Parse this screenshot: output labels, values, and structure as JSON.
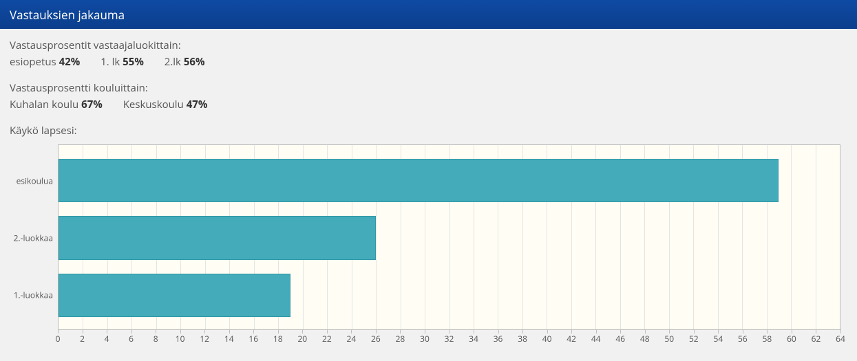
{
  "header": {
    "title": "Vastauksien jakauma"
  },
  "intro": {
    "byClass": {
      "heading": "Vastausprosentit vastaajaluokittain:",
      "items": [
        {
          "label": "esiopetus",
          "value": "42%"
        },
        {
          "label": "1. lk",
          "value": "55%"
        },
        {
          "label": "2.lk",
          "value": "56%"
        }
      ]
    },
    "bySchool": {
      "heading": "Vastausprosentti kouluittain:",
      "items": [
        {
          "label": "Kuhalan koulu",
          "value": "67%"
        },
        {
          "label": "Keskuskoulu",
          "value": "47%"
        }
      ]
    },
    "question": "Käykö lapsesi:"
  },
  "chart_data": {
    "type": "bar",
    "orientation": "horizontal",
    "categories": [
      "esikoulua",
      "2.-luokkaa",
      "1.-luokkaa"
    ],
    "values": [
      59,
      26,
      19
    ],
    "xlabel": "",
    "ylabel": "",
    "xlim": [
      0,
      64
    ],
    "xticks": [
      0,
      2,
      4,
      6,
      8,
      10,
      12,
      14,
      16,
      18,
      20,
      22,
      24,
      26,
      28,
      30,
      32,
      34,
      36,
      38,
      40,
      42,
      44,
      46,
      48,
      50,
      52,
      54,
      56,
      58,
      60,
      62,
      64
    ],
    "colors": {
      "bar": "#43abb9",
      "plot_bg": "#fffdf4",
      "grid": "#e4e4e4"
    }
  }
}
